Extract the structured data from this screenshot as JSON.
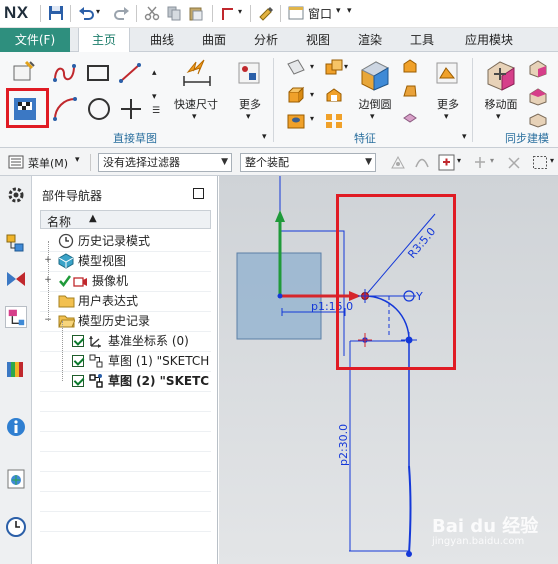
{
  "app": {
    "logo": "NX",
    "window_menu": "窗口"
  },
  "ribbon_tabs": [
    {
      "label": "文件(F)"
    },
    {
      "label": "主页"
    },
    {
      "label": "曲线"
    },
    {
      "label": "曲面"
    },
    {
      "label": "分析"
    },
    {
      "label": "视图"
    },
    {
      "label": "渲染"
    },
    {
      "label": "工具"
    },
    {
      "label": "应用模块"
    }
  ],
  "ribbon": {
    "quick_dimension": "快速尺寸",
    "more_1": "更多",
    "group_direct_sketch": "直接草图",
    "chamfer": "边倒圆",
    "more_2": "更多",
    "group_feature": "特征",
    "move_face": "移动面",
    "group_sync": "同步建模"
  },
  "selection_bar": {
    "menu_label": "菜单(M)",
    "filter_value": "没有选择过滤器",
    "scope_value": "整个装配"
  },
  "navigator": {
    "title": "部件导航器",
    "column_name": "名称",
    "items": [
      {
        "label": "历史记录模式"
      },
      {
        "label": "模型视图"
      },
      {
        "label": "摄像机"
      },
      {
        "label": "用户表达式"
      },
      {
        "label": "模型历史记录"
      },
      {
        "label": "基准坐标系 (0)"
      },
      {
        "label": "草图 (1) \"SKETCH"
      },
      {
        "label": "草图 (2) \"SKETC"
      }
    ]
  },
  "sketch": {
    "dim_radius": "R3:5.0",
    "dim_p1": "p1:15.0",
    "dim_p2": "p2:30.0",
    "axis_y": "Y"
  },
  "colors": {
    "accent": "#2e8f7e",
    "highlight": "#e01b24",
    "sketch": "#1438d8"
  },
  "watermark": {
    "brand": "Bai du 经验",
    "sub": "jingyan.baidu.com"
  }
}
